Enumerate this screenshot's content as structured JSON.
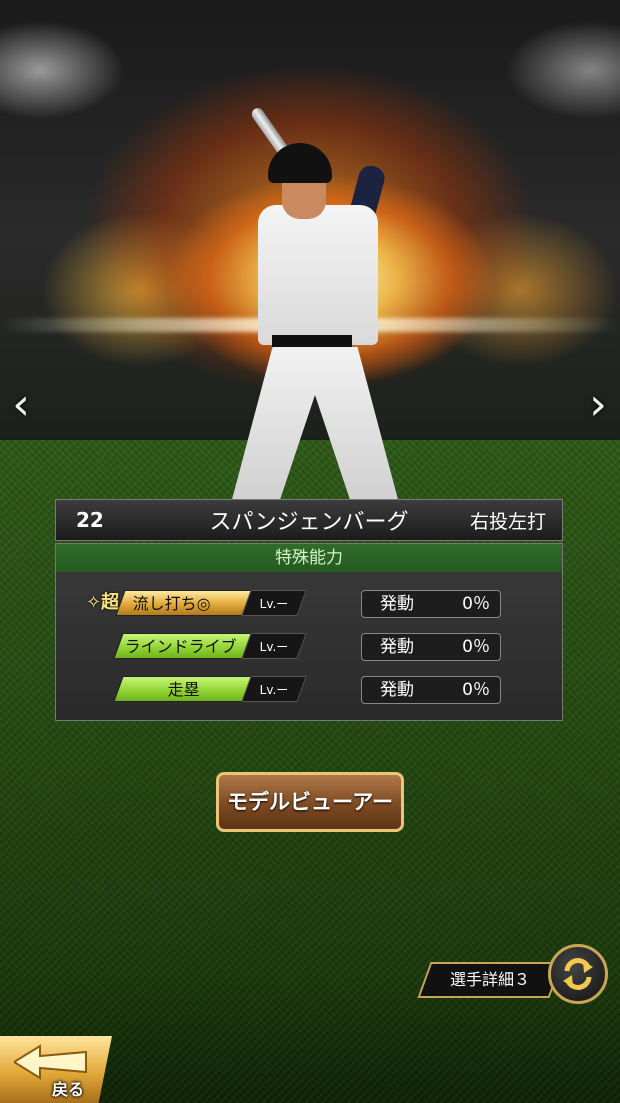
{
  "player": {
    "number": "22",
    "name": "スパンジェンバーグ",
    "handedness": "右投左打"
  },
  "nav": {
    "prev_icon": "chevron-left-icon",
    "next_icon": "chevron-right-icon",
    "prev_glyph": "‹",
    "next_glyph": "›"
  },
  "abilities": {
    "header": "特殊能力",
    "items": [
      {
        "prefix": "✧超",
        "name": "流し打ち◎",
        "level": "Lv.ー",
        "activation_label": "発動",
        "activation_rate": "0％",
        "color": "gold"
      },
      {
        "prefix": "",
        "name": "ラインドライブ",
        "level": "Lv.ー",
        "activation_label": "発動",
        "activation_rate": "0％",
        "color": "green"
      },
      {
        "prefix": "",
        "name": "走塁",
        "level": "Lv.ー",
        "activation_label": "発動",
        "activation_rate": "0％",
        "color": "green"
      }
    ]
  },
  "buttons": {
    "model_viewer": "モデルビューアー",
    "player_detail": "選手詳細３",
    "back": "戻る"
  },
  "colors": {
    "gold": "#e1a93a",
    "green": "#8ed232",
    "panel_header": "#2f6c2a",
    "button_border": "#e8c579"
  }
}
